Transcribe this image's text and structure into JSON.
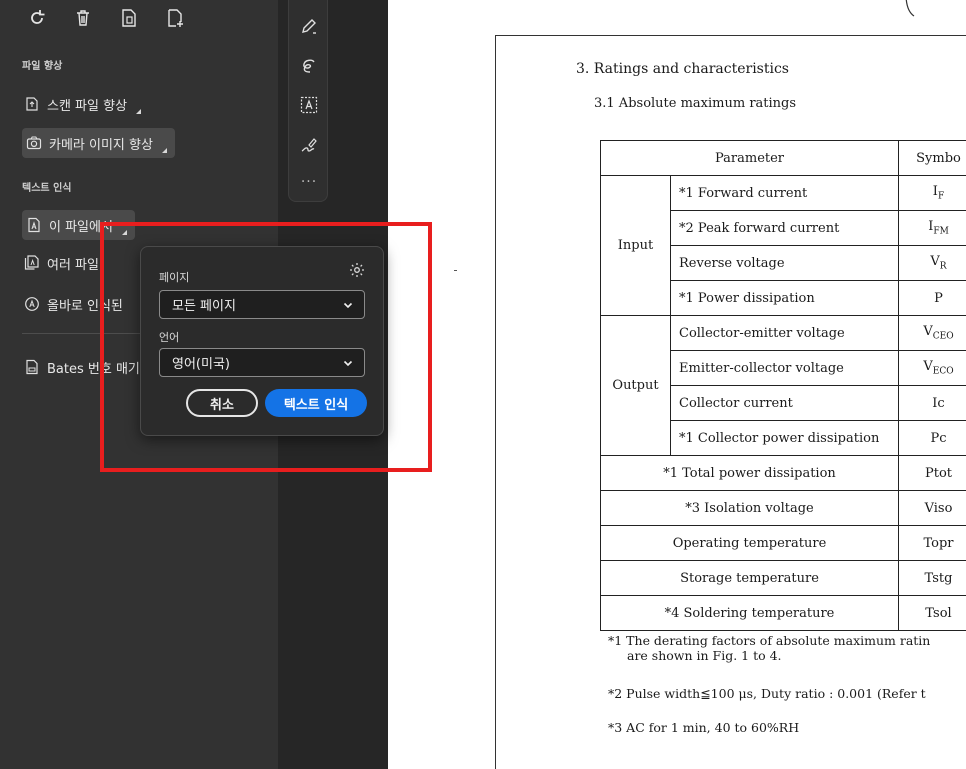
{
  "left_panel": {
    "sections": {
      "enhance": "파일 향상",
      "ocr": "텍스트 인식"
    },
    "items": {
      "scan_enhance": "스캔 파일 향상",
      "camera_enhance": "카메라 이미지 향상",
      "this_file": "이 파일에서",
      "multiple_files": "여러 파일",
      "correct_recognized": "올바로 인식된",
      "bates": "Bates 번호 매기"
    }
  },
  "popup": {
    "pages_label": "페이지",
    "pages_value": "모든 페이지",
    "language_label": "언어",
    "language_value": "영어(미국)",
    "cancel_label": "취소",
    "ok_label": "텍스트 인식"
  },
  "document": {
    "heading": "3.  Ratings and characteristics",
    "subheading": "3.1  Absolute maximum ratings",
    "table": {
      "header": {
        "parameter": "Parameter",
        "symbol": "Symbo"
      },
      "groups": {
        "input": "Input",
        "output": "Output"
      },
      "rows": [
        {
          "param": "*1  Forward current",
          "sym": "I",
          "sub": "F"
        },
        {
          "param": "*2  Peak forward current",
          "sym": "I",
          "sub": "FM"
        },
        {
          "param": "Reverse voltage",
          "sym": "V",
          "sub": "R"
        },
        {
          "param": "*1  Power dissipation",
          "sym": "P",
          "sub": ""
        },
        {
          "param": "Collector-emitter voltage",
          "sym": "V",
          "sub": "CEO"
        },
        {
          "param": "Emitter-collector voltage",
          "sym": "V",
          "sub": "ECO"
        },
        {
          "param": "Collector current",
          "sym": "Ic",
          "sub": ""
        },
        {
          "param": "*1  Collector power dissipation",
          "sym": "Pc",
          "sub": ""
        },
        {
          "param": "*1  Total power dissipation",
          "sym": "Ptot",
          "sub": ""
        },
        {
          "param": "*3  Isolation voltage",
          "sym": "Viso",
          "sub": ""
        },
        {
          "param": "Operating temperature",
          "sym": "Topr",
          "sub": ""
        },
        {
          "param": "Storage temperature",
          "sym": "Tstg",
          "sub": ""
        },
        {
          "param": "*4  Soldering temperature",
          "sym": "Tsol",
          "sub": ""
        }
      ]
    },
    "footnotes": {
      "f1_line1": "*1  The derating factors of absolute maximum ratin",
      "f1_line2": "are shown in Fig. 1 to 4.",
      "f2": "*2  Pulse width≦100 μs, Duty ratio : 0.001  (Refer t",
      "f3": "*3  AC for 1 min, 40 to 60%RH"
    }
  },
  "colors": {
    "highlight": "#e81e1e",
    "primary_button": "#1473e6",
    "panel": "#323232"
  }
}
